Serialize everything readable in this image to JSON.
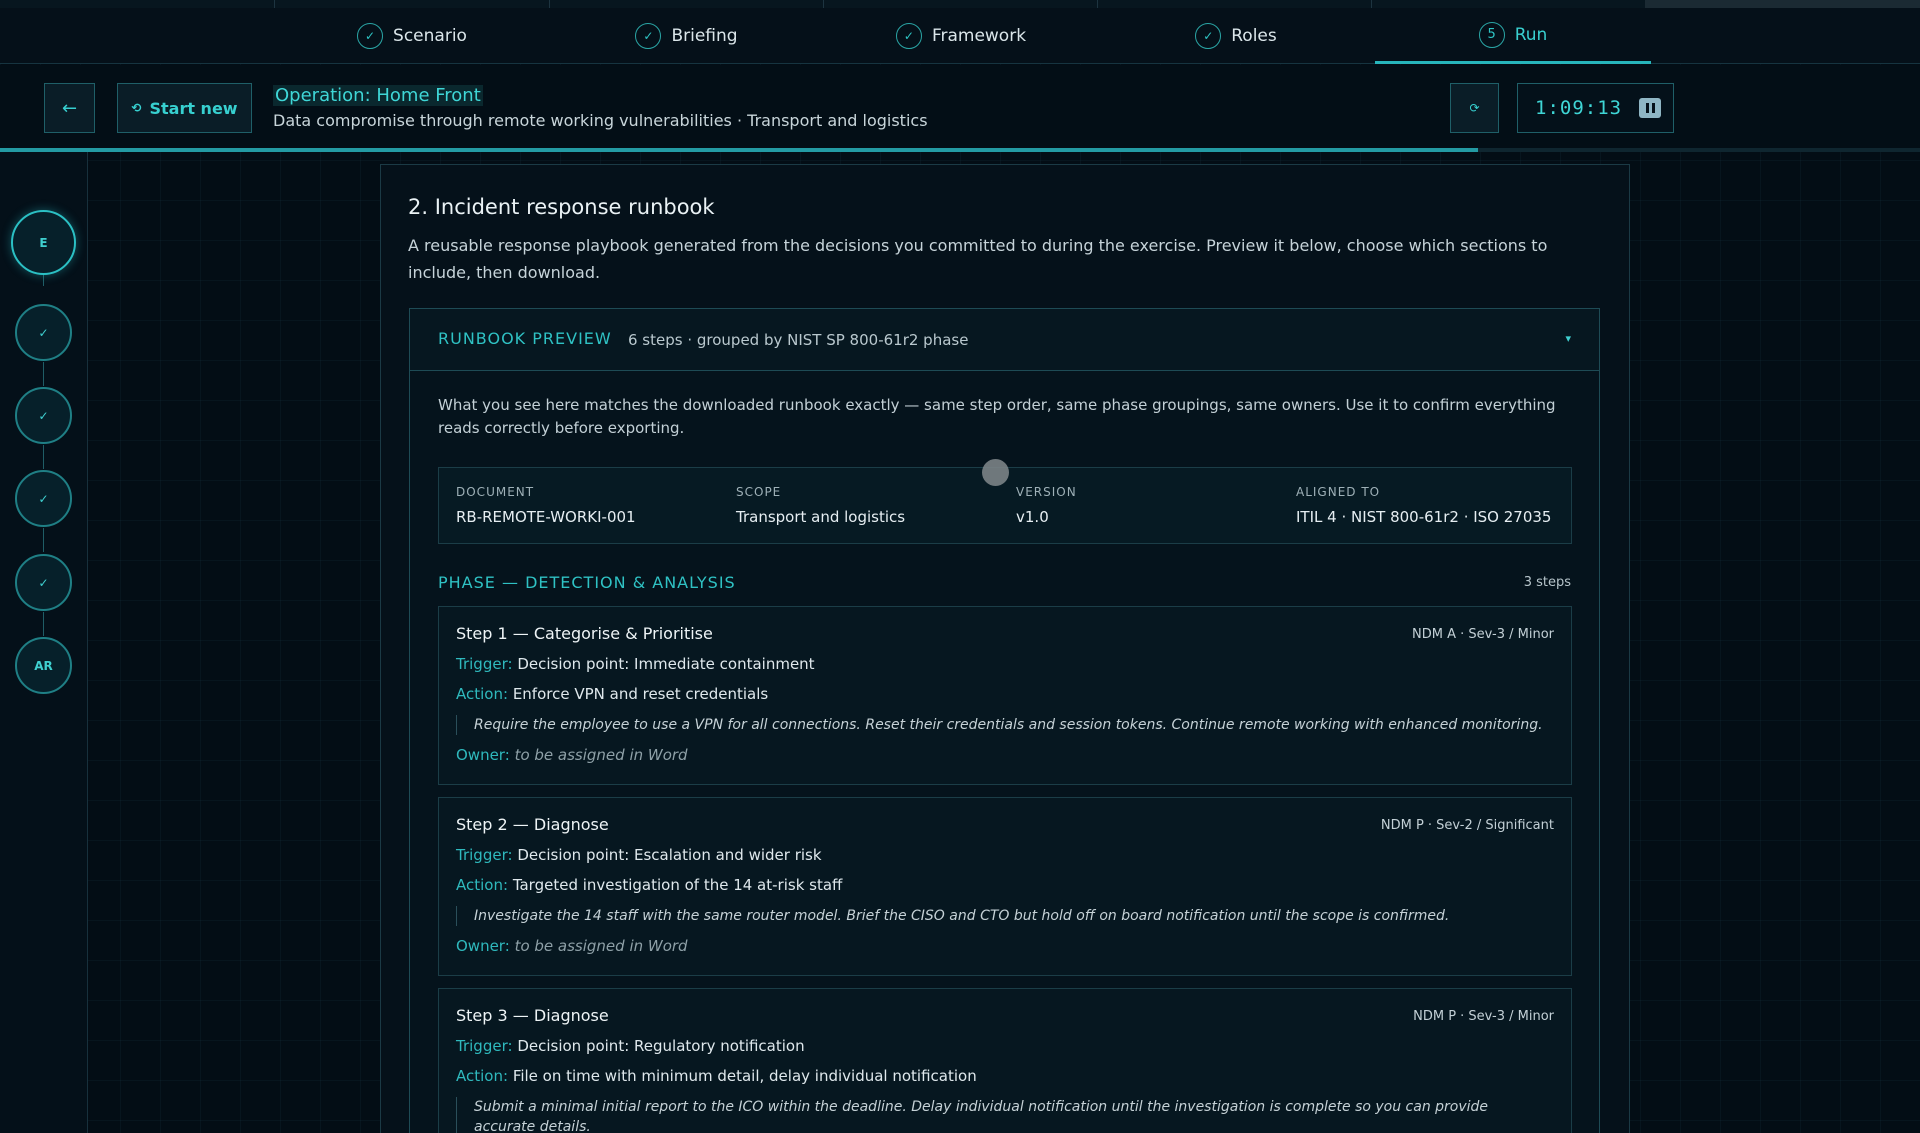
{
  "tabs": [
    {
      "label": "Scenario",
      "icon": "check",
      "state": "done"
    },
    {
      "label": "Briefing",
      "icon": "check",
      "state": "done"
    },
    {
      "label": "Framework",
      "icon": "check",
      "state": "done"
    },
    {
      "label": "Roles",
      "icon": "check",
      "state": "done"
    },
    {
      "label": "Run",
      "number": "5",
      "state": "active"
    }
  ],
  "header": {
    "back_icon": "←",
    "start_new_icon": "⟲",
    "start_new_label": "Start new",
    "title": "Operation: Home Front",
    "subtitle": "Data compromise through remote working vulnerabilities · Transport and logistics",
    "refresh_icon": "⟳",
    "timer": "1:09:13",
    "progress_fraction": 0.77
  },
  "rail": {
    "nodes": [
      {
        "label": "E",
        "state": "current"
      },
      {
        "label": "✓",
        "state": "done"
      },
      {
        "label": "✓",
        "state": "done"
      },
      {
        "label": "✓",
        "state": "done"
      },
      {
        "label": "✓",
        "state": "done"
      },
      {
        "label": "AR",
        "state": "pending"
      }
    ]
  },
  "section": {
    "title": "2. Incident response runbook",
    "intro": "A reusable response playbook generated from the decisions you committed to during the exercise. Preview it below, choose which sections to include, then download."
  },
  "preview": {
    "title": "RUNBOOK PREVIEW",
    "meta": "6 steps · grouped by NIST SP 800-61r2 phase",
    "caret": "▾",
    "note": "What you see here matches the downloaded runbook exactly — same step order, same phase groupings, same owners. Use it to confirm everything reads correctly before exporting.",
    "doc": {
      "document_label": "DOCUMENT",
      "document_value": "RB-REMOTE-WORKI-001",
      "scope_label": "SCOPE",
      "scope_value": "Transport and logistics",
      "version_label": "VERSION",
      "version_value": "v1.0",
      "aligned_label": "ALIGNED TO",
      "aligned_value": "ITIL 4 · NIST 800-61r2 · ISO 27035"
    },
    "phase": {
      "title": "PHASE — DETECTION & ANALYSIS",
      "count": "3 steps"
    },
    "labels": {
      "trigger": "Trigger:",
      "action": "Action:",
      "owner": "Owner:"
    },
    "steps": [
      {
        "title": "Step 1 — Categorise & Prioritise",
        "tag": "NDM A · Sev-3 / Minor",
        "trigger": "Decision point: Immediate containment",
        "action": "Enforce VPN and reset credentials",
        "desc": "Require the employee to use a VPN for all connections. Reset their credentials and session tokens. Continue remote working with enhanced monitoring.",
        "owner": "to be assigned in Word"
      },
      {
        "title": "Step 2 — Diagnose",
        "tag": "NDM P · Sev-2 / Significant",
        "trigger": "Decision point: Escalation and wider risk",
        "action": "Targeted investigation of the 14 at-risk staff",
        "desc": "Investigate the 14 staff with the same router model. Brief the CISO and CTO but hold off on board notification until the scope is confirmed.",
        "owner": "to be assigned in Word"
      },
      {
        "title": "Step 3 — Diagnose",
        "tag": "NDM P · Sev-3 / Minor",
        "trigger": "Decision point: Regulatory notification",
        "action": "File on time with minimum detail, delay individual notification",
        "desc": "Submit a minimal initial report to the ICO within the deadline. Delay individual notification until the investigation is complete so you can provide accurate details.",
        "owner": ""
      }
    ]
  }
}
